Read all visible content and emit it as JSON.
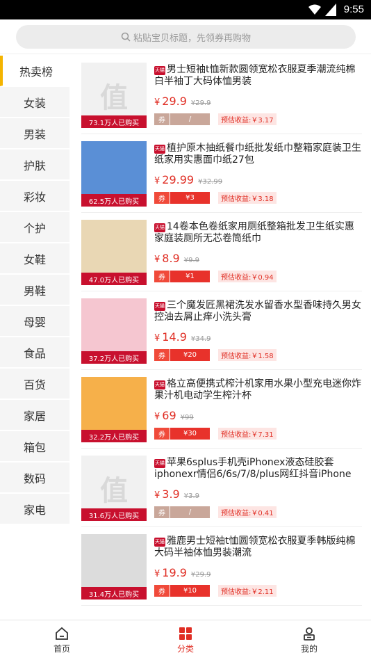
{
  "status": {
    "time": "9:55"
  },
  "search": {
    "placeholder": "粘贴宝贝标题，先领券再购物"
  },
  "sidebar": {
    "items": [
      {
        "label": "热卖榜",
        "active": true
      },
      {
        "label": "女装"
      },
      {
        "label": "男装"
      },
      {
        "label": "护肤"
      },
      {
        "label": "彩妆"
      },
      {
        "label": "个护"
      },
      {
        "label": "女鞋"
      },
      {
        "label": "男鞋"
      },
      {
        "label": "母婴"
      },
      {
        "label": "食品"
      },
      {
        "label": "百货"
      },
      {
        "label": "家居"
      },
      {
        "label": "箱包"
      },
      {
        "label": "数码"
      },
      {
        "label": "家电"
      }
    ]
  },
  "products": [
    {
      "title": "男士短袖t恤新款圆领宽松衣服夏季潮流纯棉白半袖丁大码体恤男装",
      "price": "29.9",
      "orig": "¥29.9",
      "sold": "73.1万人已购买",
      "coupon_label": "券",
      "coupon": "/",
      "earn": "预估收益:￥3.17",
      "thumb": "值",
      "dim": true
    },
    {
      "title": "植护原木抽纸餐巾纸批发纸巾整箱家庭装卫生纸家用实惠面巾纸27包",
      "price": "29.99",
      "orig": "¥32.99",
      "sold": "62.5万人已购买",
      "coupon_label": "券",
      "coupon": "¥3",
      "earn": "预估收益:￥3.18",
      "thumb": "",
      "dim": false
    },
    {
      "title": "14卷本色卷纸家用厕纸整箱批发卫生纸实惠家庭装厕所无芯卷筒纸巾",
      "price": "8.9",
      "orig": "¥9.9",
      "sold": "47.0万人已购买",
      "coupon_label": "券",
      "coupon": "¥1",
      "earn": "预估收益:￥0.94",
      "thumb": "",
      "dim": false
    },
    {
      "title": "三个魔发匠黑裙洗发水留香水型香味持久男女控油去屑止痒小洗头膏",
      "price": "14.9",
      "orig": "¥34.9",
      "sold": "37.2万人已购买",
      "coupon_label": "券",
      "coupon": "¥20",
      "earn": "预估收益:￥1.58",
      "thumb": "",
      "dim": false
    },
    {
      "title": "格立高便携式榨汁机家用水果小型充电迷你炸果汁机电动学生榨汁杯",
      "price": "69",
      "orig": "¥99",
      "sold": "32.2万人已购买",
      "coupon_label": "券",
      "coupon": "¥30",
      "earn": "预估收益:￥7.31",
      "thumb": "",
      "dim": false
    },
    {
      "title": "苹果6splus手机壳iPhonex液态硅胶套iphonexr情侣6/6s/7/8/plus网红抖音iPhone x...",
      "price": "3.9",
      "orig": "¥3.9",
      "sold": "31.6万人已购买",
      "coupon_label": "券",
      "coupon": "/",
      "earn": "预估收益:￥0.41",
      "thumb": "值",
      "dim": true
    },
    {
      "title": "雅鹿男士短袖t恤圆领宽松衣服夏季韩版纯棉大码半袖体恤男装潮流",
      "price": "19.9",
      "orig": "¥29.9",
      "sold": "31.4万人已购买",
      "coupon_label": "券",
      "coupon": "¥10",
      "earn": "预估收益:￥2.11",
      "thumb": "",
      "dim": false
    }
  ],
  "tabs": [
    {
      "label": "首页",
      "icon": "home-icon"
    },
    {
      "label": "分类",
      "icon": "category-icon",
      "active": true
    },
    {
      "label": "我的",
      "icon": "profile-icon"
    }
  ],
  "colors": {
    "accent": "#e02e24",
    "sold_bg": "#c8102e",
    "active_bar": "#f4b400"
  }
}
